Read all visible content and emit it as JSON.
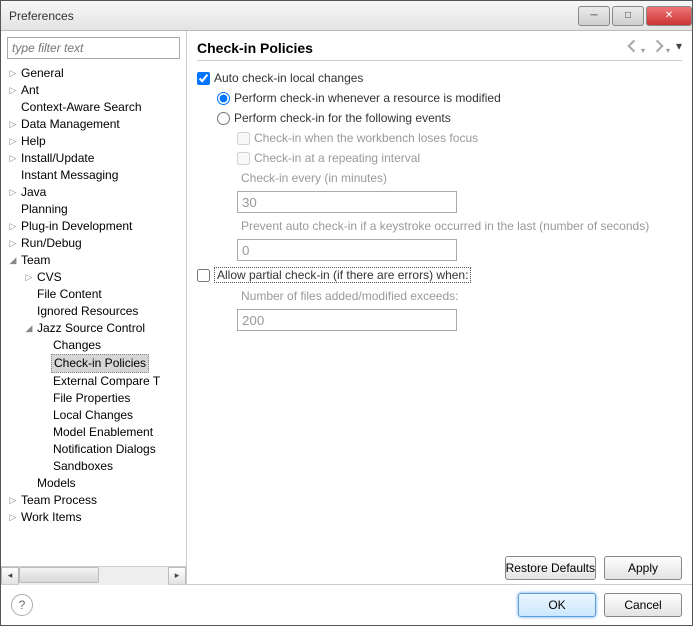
{
  "window": {
    "title": "Preferences"
  },
  "filter": {
    "placeholder": "type filter text"
  },
  "tree": {
    "items": [
      {
        "label": "General",
        "level": 0,
        "expand": "▷"
      },
      {
        "label": "Ant",
        "level": 0,
        "expand": "▷"
      },
      {
        "label": "Context-Aware Search",
        "level": 0,
        "expand": ""
      },
      {
        "label": "Data Management",
        "level": 0,
        "expand": "▷"
      },
      {
        "label": "Help",
        "level": 0,
        "expand": "▷"
      },
      {
        "label": "Install/Update",
        "level": 0,
        "expand": "▷"
      },
      {
        "label": "Instant Messaging",
        "level": 0,
        "expand": ""
      },
      {
        "label": "Java",
        "level": 0,
        "expand": "▷"
      },
      {
        "label": "Planning",
        "level": 0,
        "expand": ""
      },
      {
        "label": "Plug-in Development",
        "level": 0,
        "expand": "▷"
      },
      {
        "label": "Run/Debug",
        "level": 0,
        "expand": "▷"
      },
      {
        "label": "Team",
        "level": 0,
        "expand": "◢"
      },
      {
        "label": "CVS",
        "level": 1,
        "expand": "▷"
      },
      {
        "label": "File Content",
        "level": 1,
        "expand": ""
      },
      {
        "label": "Ignored Resources",
        "level": 1,
        "expand": ""
      },
      {
        "label": "Jazz Source Control",
        "level": 1,
        "expand": "◢"
      },
      {
        "label": "Changes",
        "level": 2,
        "expand": ""
      },
      {
        "label": "Check-in Policies",
        "level": 2,
        "expand": "",
        "selected": true
      },
      {
        "label": "External Compare T",
        "level": 2,
        "expand": ""
      },
      {
        "label": "File Properties",
        "level": 2,
        "expand": ""
      },
      {
        "label": "Local Changes",
        "level": 2,
        "expand": ""
      },
      {
        "label": "Model Enablement",
        "level": 2,
        "expand": ""
      },
      {
        "label": "Notification Dialogs",
        "level": 2,
        "expand": ""
      },
      {
        "label": "Sandboxes",
        "level": 2,
        "expand": ""
      },
      {
        "label": "Models",
        "level": 1,
        "expand": ""
      },
      {
        "label": "Team Process",
        "level": 0,
        "expand": "▷"
      },
      {
        "label": "Work Items",
        "level": 0,
        "expand": "▷"
      }
    ]
  },
  "page": {
    "title": "Check-in Policies",
    "autoCheckinLabel": "Auto check-in local changes",
    "autoCheckin": true,
    "performModified": "Perform check-in whenever a resource is modified",
    "performEvents": "Perform check-in for the following events",
    "modeSelected": "modified",
    "evtLoseFocus": "Check-in when the workbench loses focus",
    "evtInterval": "Check-in at a repeating interval",
    "intervalLabel": "Check-in every (in minutes)",
    "intervalValue": "30",
    "preventLabel": "Prevent auto check-in if a keystroke occurred in the last (number of seconds)",
    "preventValue": "0",
    "allowPartialLabel": "Allow partial check-in (if there are errors) when:",
    "numFilesLabel": "Number of files added/modified exceeds:",
    "numFilesValue": "200"
  },
  "buttons": {
    "restore": "Restore Defaults",
    "apply": "Apply",
    "ok": "OK",
    "cancel": "Cancel"
  }
}
